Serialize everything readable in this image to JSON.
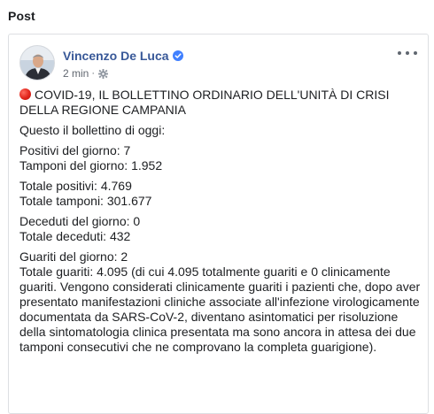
{
  "section_title": "Post",
  "post": {
    "author": "Vincenzo De Luca",
    "verified_icon": "verified-badge-icon",
    "time": "2 min",
    "separator": "·",
    "audience_icon": "gear-icon",
    "more_icon": "more-options-icon",
    "accent_color": "#385898",
    "lines": {
      "title": "COVID-19, IL BOLLETTINO ORDINARIO DELL'UNITÀ DI CRISI DELLA REGIONE CAMPANIA",
      "intro": "Questo il bollettino di oggi:",
      "positivi_giorno": "Positivi del giorno: 7",
      "tamponi_giorno": "Tamponi del giorno: 1.952",
      "totale_positivi": "Totale positivi: 4.769",
      "totale_tamponi": "Totale tamponi: 301.677",
      "deceduti_giorno": "Deceduti del giorno: 0",
      "totale_deceduti": "Totale deceduti: 432",
      "guariti_giorno": "Guariti del giorno: 2",
      "totale_guariti": "Totale guariti: 4.095 (di cui 4.095 totalmente guariti e 0 clinicamente guariti. Vengono considerati clinicamente guariti i pazienti che, dopo aver presentato manifestazioni cliniche associate all'infezione virologicamente documentata da SARS-CoV-2, diventano asintomatici per risoluzione della sintomatologia clinica presentata ma sono ancora in attesa dei due tamponi consecutivi che ne comprovano la completa guarigione)."
    }
  }
}
